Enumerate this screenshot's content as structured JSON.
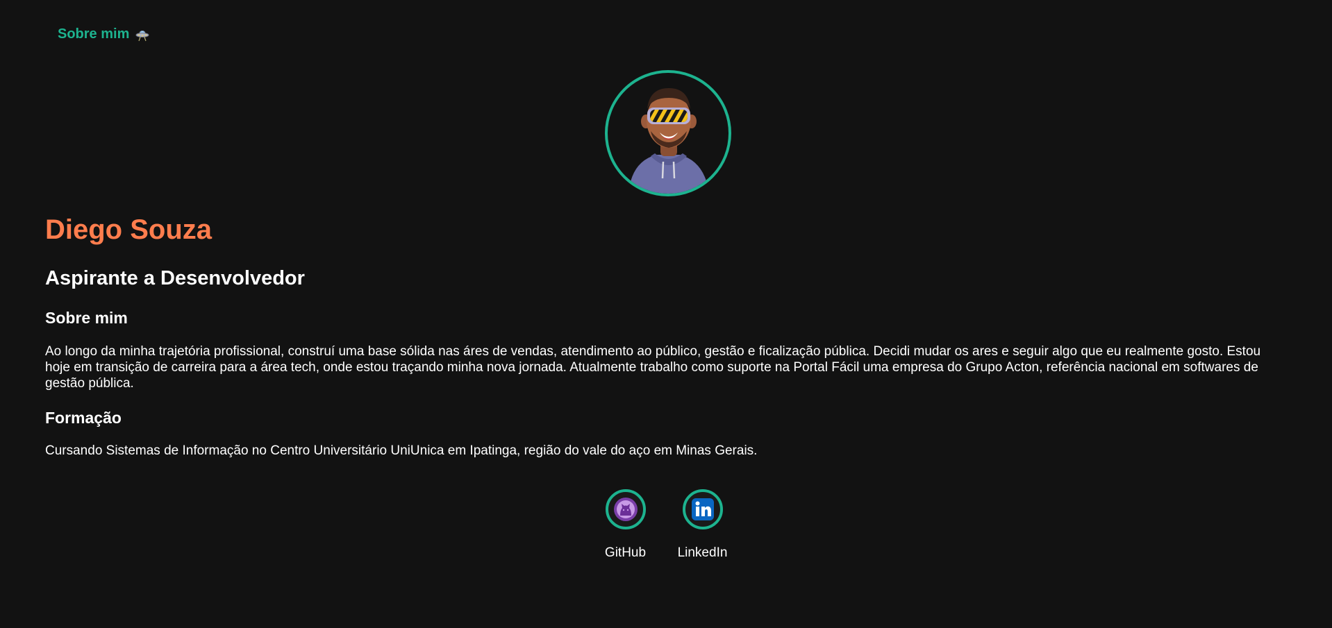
{
  "nav": {
    "link_label": "Sobre mim",
    "icon": "ufo-icon"
  },
  "profile": {
    "avatar": "memoji-avatar-vr-headset",
    "name": "Diego Souza",
    "role": "Aspirante a Desenvolvedor"
  },
  "about": {
    "heading": "Sobre mim",
    "text": "Ao longo da minha trajetória profissional, construí uma base sólida nas áres de vendas, atendimento ao público, gestão e ficalização pública. Decidi mudar os ares e seguir algo que eu realmente gosto. Estou hoje em transição de carreira para a área tech, onde estou traçando minha nova jornada. Atualmente trabalho como suporte na Portal Fácil uma empresa do Grupo Acton, referência nacional em softwares de gestão pública."
  },
  "education": {
    "heading": "Formação",
    "text": "Cursando Sistemas de Informação no Centro Universitário UniUnica em Ipatinga, região do vale do aço em Minas Gerais."
  },
  "socials": [
    {
      "label": "GitHub",
      "icon": "github-icon"
    },
    {
      "label": "LinkedIn",
      "icon": "linkedin-icon"
    }
  ],
  "colors": {
    "background": "#121212",
    "accent": "#1db38f",
    "name": "#ff7d4d",
    "text": "#ffffff"
  }
}
